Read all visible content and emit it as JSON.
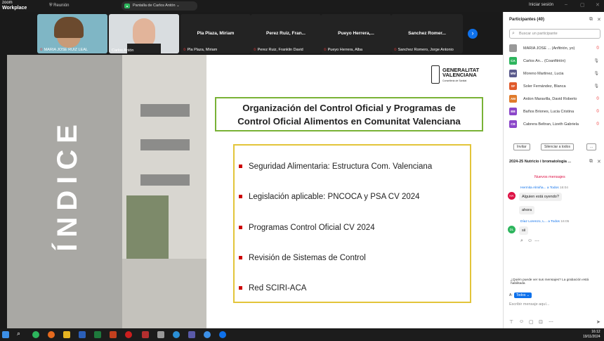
{
  "app": {
    "logo_top": "zoom",
    "logo_bottom": "Workplace",
    "meeting": "Reunión",
    "share_label": "Pantalla de Carlos Antón",
    "login": "Iniciar sesión"
  },
  "strip": {
    "tiles": [
      {
        "name": "MARIA JOSE RUIZ LEAL",
        "center": ""
      },
      {
        "name": "Carlos Antón",
        "center": ""
      },
      {
        "name": "Pla Plaza, Miriam",
        "center": "Pla Plaza, Miriam"
      },
      {
        "name": "Perez Ruiz, Franklin David",
        "center": "Perez Ruiz, Fran..."
      },
      {
        "name": "Pueyo Herrera, Alba",
        "center": "Pueyo Herrera,..."
      },
      {
        "name": "Sanchez Romero, Jorge Antonio",
        "center": "Sanchez Romer..."
      }
    ]
  },
  "slide": {
    "side_title": "ÍNDICE",
    "logo_line1": "GENERALITAT",
    "logo_line2": "VALENCIANA",
    "logo_sub": "Conselleria de Sanitat",
    "title_line1": "Organización del Control Oficial y Programas de",
    "title_line2": "Control Oficial Alimentos en Comunitat Valenciana",
    "items": [
      "Seguridad Alimentaria: Estructura Com. Valenciana",
      "Legislación aplicable: PNCOCA y PSA CV 2024",
      "Programas Control Oficial CV 2024",
      "Revisión de Sistemas de Control",
      "Red SCIRI-ACA"
    ]
  },
  "participants": {
    "header": "Participantes (40)",
    "search_placeholder": "Buscar un participante",
    "list": [
      {
        "initials": "",
        "name": "MARIA JOSE ... (Anfitrión, yo)",
        "color": "#999"
      },
      {
        "initials": "CA",
        "name": "Carlos An... (Coanfitrión)",
        "color": "#2db55d"
      },
      {
        "initials": "MM",
        "name": "Moreno Martinez, Lucia",
        "color": "#5a5a8c"
      },
      {
        "initials": "SF",
        "name": "Soler Fernández, Blanca",
        "color": "#e05a2b"
      },
      {
        "initials": "AM",
        "name": "Ardon Maravilla, David Roberto",
        "color": "#e07b2b"
      },
      {
        "initials": "BB",
        "name": "Baños Briones, Lucia Cristina",
        "color": "#8b46c9"
      },
      {
        "initials": "CB",
        "name": "Cabrera Beltran, Lizeth Gabriela",
        "color": "#8b46c9"
      }
    ],
    "invite": "Invitar",
    "mute_all": "Silenciar a todos",
    "more": "..."
  },
  "chat": {
    "header": "2024-25 Nutricio i bromatologia ...",
    "new_messages": "Nuevos mensajes",
    "messages": [
      {
        "initials": "HA",
        "sender": "Hermita Almiña...",
        "to": "a Todos",
        "time": "16:04",
        "texts": [
          "Alguien está oyendo?",
          "ahora"
        ]
      },
      {
        "initials": "DL",
        "sender": "Díaz Lorenzo, L...",
        "to": "a Todos",
        "time": "16:05",
        "texts": [
          "sii"
        ]
      }
    ],
    "note": "¿Quién puede ver sus mensajes? La grabación está habilitada",
    "to_label": "A:",
    "to_value": "Todos",
    "input_placeholder": "Escribir mensaje aquí..."
  },
  "taskbar": {
    "time": "16:12",
    "date": "19/11/2024"
  }
}
